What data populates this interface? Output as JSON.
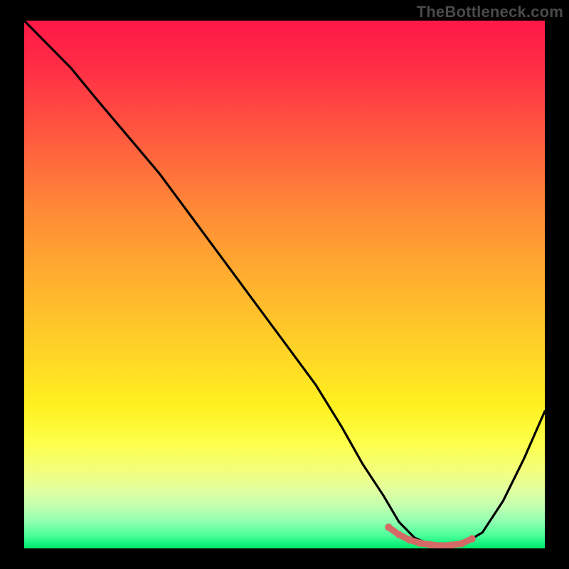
{
  "watermark": "TheBottleneck.com",
  "colors": {
    "curve_stroke": "#000000",
    "marks_stroke": "#d46a66",
    "background_top": "#ff1846",
    "background_bottom": "#03e66a",
    "frame": "#000000"
  },
  "chart_data": {
    "type": "line",
    "title": "",
    "xlabel": "",
    "ylabel": "",
    "xlim": [
      0,
      100
    ],
    "ylim": [
      0,
      100
    ],
    "grid": false,
    "legend": false,
    "series": [
      {
        "name": "bottleneck-curve",
        "x": [
          0,
          4,
          9,
          14,
          20,
          26,
          32,
          38,
          44,
          50,
          56,
          61,
          65,
          69,
          72,
          75,
          78,
          81,
          84,
          88,
          92,
          96,
          100
        ],
        "y": [
          100,
          96,
          91,
          85,
          78,
          71,
          63,
          55,
          47,
          39,
          31,
          23,
          16,
          10,
          5,
          2,
          0.7,
          0.5,
          0.7,
          3,
          9,
          17,
          26
        ]
      }
    ],
    "highlight_segment": {
      "name": "flat-valley-marks",
      "x": [
        70,
        72,
        74,
        76,
        78,
        80,
        82,
        84,
        86
      ],
      "y": [
        4,
        2.6,
        1.6,
        1.0,
        0.7,
        0.5,
        0.6,
        0.9,
        1.8
      ]
    }
  }
}
